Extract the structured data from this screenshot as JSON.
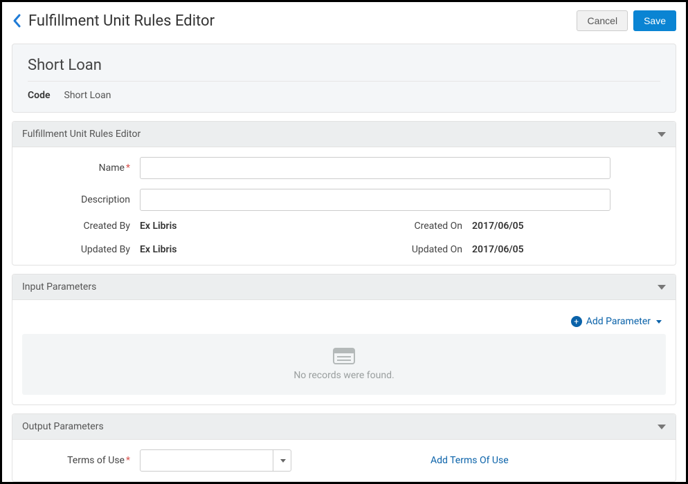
{
  "header": {
    "page_title": "Fulfillment Unit Rules Editor",
    "cancel_label": "Cancel",
    "save_label": "Save"
  },
  "summary": {
    "title": "Short Loan",
    "code_label": "Code",
    "code_value": "Short Loan"
  },
  "panels": {
    "editor": {
      "title": "Fulfillment Unit Rules Editor",
      "name_label": "Name",
      "name_value": "",
      "description_label": "Description",
      "description_value": "",
      "created_by_label": "Created By",
      "created_by_value": "Ex Libris",
      "created_on_label": "Created On",
      "created_on_value": "2017/06/05",
      "updated_by_label": "Updated By",
      "updated_by_value": "Ex Libris",
      "updated_on_label": "Updated On",
      "updated_on_value": "2017/06/05"
    },
    "input_params": {
      "title": "Input Parameters",
      "add_label": "Add Parameter",
      "empty_text": "No records were found."
    },
    "output_params": {
      "title": "Output Parameters",
      "terms_of_use_label": "Terms of Use",
      "terms_of_use_value": "",
      "add_terms_label": "Add Terms Of Use"
    }
  }
}
